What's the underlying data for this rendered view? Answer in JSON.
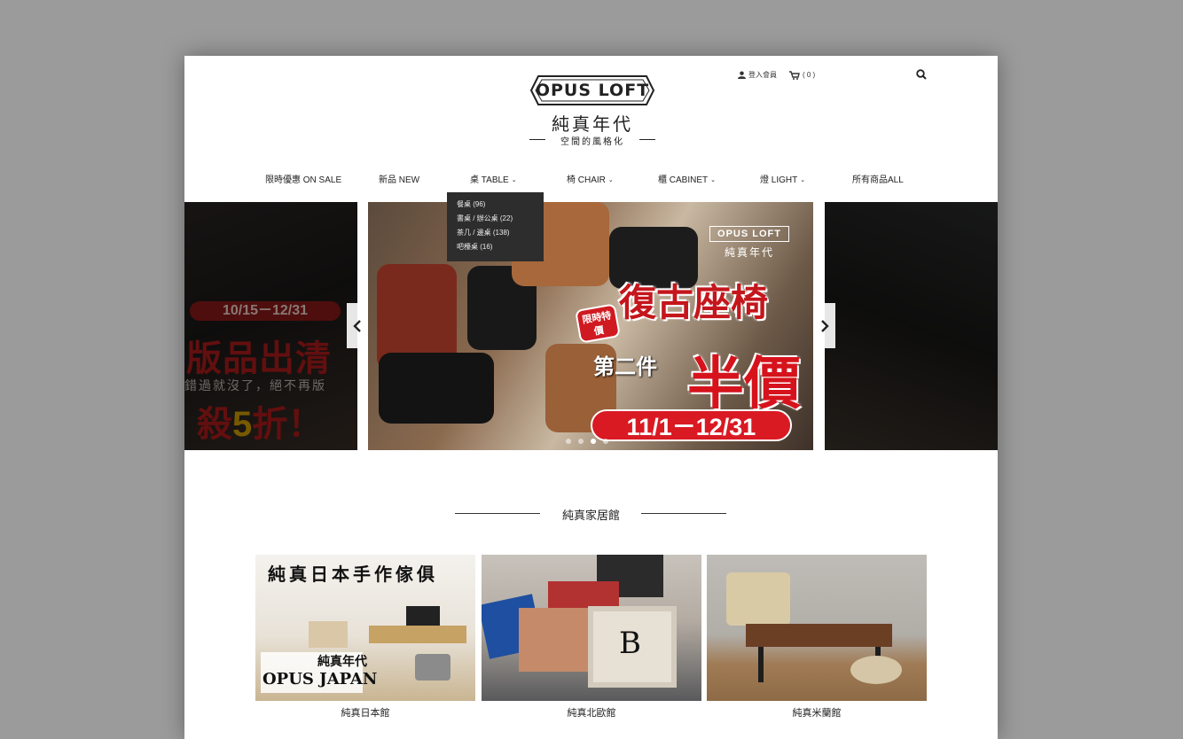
{
  "header": {
    "logo_en": "OPUS LOFT",
    "logo_cn": "純真年代",
    "logo_sub": "空間的風格化",
    "login_label": "登入會員",
    "cart_label": "( 0 )"
  },
  "nav": {
    "items": [
      {
        "label": "限時優惠 ON SALE"
      },
      {
        "label": "新品 NEW"
      },
      {
        "label": "桌 TABLE"
      },
      {
        "label": "椅 CHAIR"
      },
      {
        "label": "櫃 CABINET"
      },
      {
        "label": "燈 LIGHT"
      },
      {
        "label": "所有商品ALL"
      }
    ],
    "dropdown": [
      "餐桌 (96)",
      "書桌 / 辦公桌 (22)",
      "茶几 / 邊桌 (138)",
      "吧檯桌 (16)"
    ]
  },
  "slider": {
    "left": {
      "date": "10/15－12/31",
      "title": "版品出清",
      "note": "錯過就沒了，絕不再版",
      "sale_a": "殺",
      "sale_b": "5",
      "sale_c": "折！"
    },
    "main": {
      "logo_en": "OPUS LOFT",
      "logo_cn": "純真年代",
      "badge": "限時特價",
      "title": "復古座椅",
      "second": "第二件",
      "half": "半價",
      "date": "11/1－12/31"
    }
  },
  "section": {
    "title": "純真家居館",
    "cards": [
      {
        "label": "純真日本館",
        "banner": "純真日本手作傢俱",
        "brand": "OPUS JAPAN",
        "brand_cn": "純真年代"
      },
      {
        "label": "純真北歐館"
      },
      {
        "label": "純真米蘭館"
      }
    ]
  },
  "colors": {
    "accent_red": "#d91a23",
    "dropdown_bg": "#2d2d2d"
  }
}
